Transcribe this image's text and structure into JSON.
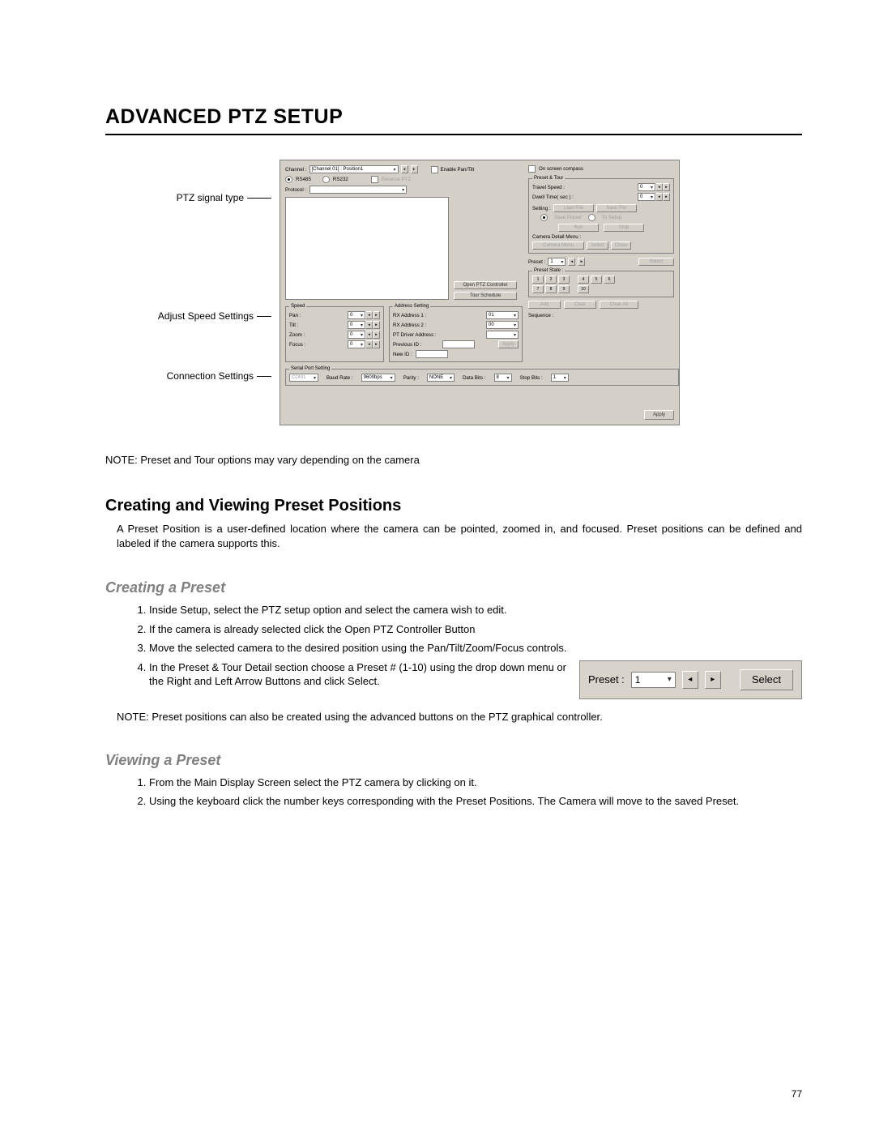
{
  "page_number": "77",
  "title": "ADVANCED PTZ SETUP",
  "callouts": {
    "signal_type": "PTZ signal type",
    "speed_settings": "Adjust Speed Settings",
    "connection_settings": "Connection Settings"
  },
  "dialog": {
    "channel_label": "Channel :",
    "channel_value": "[Channel 01] : Position1",
    "enable_pt": "Enable Pan/Tilt",
    "reverse_ptz": "Reverse PTZ",
    "onscreen_compass": "On screen compass",
    "signal_rs485": "RS485",
    "signal_rs232": "RS232",
    "protocol_label": "Protocol :",
    "open_ptz": "Open PTZ Controller",
    "tour_schedule": "Tour Schedule",
    "speed_group": "Speed",
    "pan_label": "Pan :",
    "tilt_label": "Tilt :",
    "zoom_label": "Zoom :",
    "focus_label": "Focus :",
    "speed_val": "0",
    "addr_group": "Address Setting",
    "rx1": "RX Address 1 :",
    "rx1_val": "01",
    "rx2": "RX Address 2 :",
    "rx2_val": "00",
    "ptdrv": "PT Driver Address :",
    "previd": "Previous ID :",
    "newid": "New ID :",
    "addr_apply": "Apply",
    "serial_group": "Serial Port Setting",
    "com": "COM1",
    "baud_label": "Baud Rate :",
    "baud_val": "9600bps",
    "parity_label": "Parity :",
    "parity_val": "NONE",
    "databits_label": "Data Bits :",
    "databits_val": "8",
    "stopbits_label": "Stop Bits :",
    "stopbits_val": "1",
    "preset_tour_group": "Preset & Tour",
    "travel_speed": "Travel Speed :",
    "travel_val": "0",
    "dwell": "Dwell Time( sec ) :",
    "dwell_val": "0",
    "setting": "Setting :",
    "load_file": "Load File",
    "save_file": "Save File",
    "save_preset": "Save Preset",
    "to_setup": "To Setup",
    "run_btn": "Run",
    "stop_btn": "Stop",
    "cam_detail": "Camera Detail Menu :",
    "cam_menu": "Camera Menu",
    "select_small": "Select",
    "close_small": "Close",
    "preset_group": "Preset :",
    "preset_val": "1",
    "select_btn": "Select",
    "preset_state": "Preset State :",
    "add": "Add",
    "clear": "Clear",
    "clearall": "Clear All",
    "sequence": "Sequence :",
    "apply": "Apply"
  },
  "note1": "NOTE: Preset and Tour options may vary depending on the camera",
  "section1": {
    "heading": "Creating and Viewing Preset Positions",
    "body": "A Preset Position is a user-defined location where the camera can be pointed, zoomed in, and focused.  Preset positions can be defined and labeled if the camera supports this."
  },
  "creating": {
    "heading": "Creating a Preset",
    "steps": [
      "Inside Setup, select the PTZ setup option and select the camera wish to edit.",
      "If the camera is already selected click the Open PTZ Controller Button",
      "Move the selected camera to the desired position using the Pan/Tilt/Zoom/Focus controls.",
      "In the Preset & Tour Detail section choose a Preset # (1-10) using the drop down menu or the Right and Left Arrow Buttons and click Select."
    ],
    "note": "NOTE: Preset positions can also be created using the advanced buttons on the PTZ graphical controller."
  },
  "inset": {
    "label": "Preset :",
    "value": "1",
    "select": "Select"
  },
  "viewing": {
    "heading": "Viewing a Preset",
    "steps": [
      "From the Main Display Screen select the PTZ camera by clicking on it.",
      "Using the keyboard click the number keys corresponding with the Preset Positions.  The Camera will move to the saved Preset."
    ]
  }
}
